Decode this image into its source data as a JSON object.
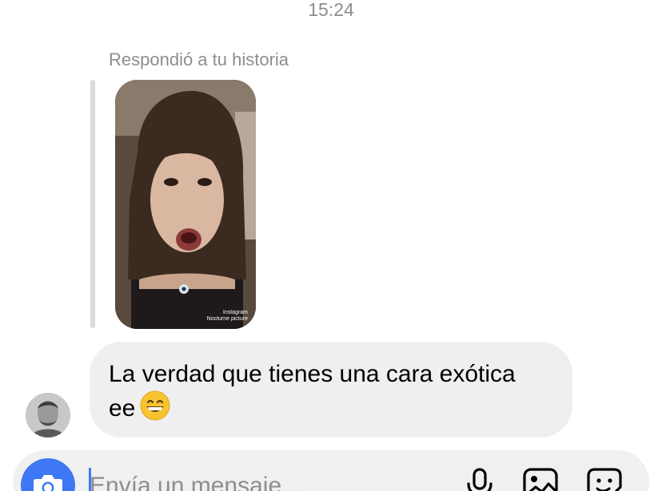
{
  "header": {
    "time": "15:24"
  },
  "thread": {
    "reply_context": "Respondió a tu historia",
    "story": {
      "caption_line1": "Instagram",
      "caption_line2": "Nocturne picture"
    },
    "message": {
      "line1": "La verdad que tienes una cara exótica",
      "line2": "ee",
      "emoji": "grinning-face-with-smiling-eyes"
    }
  },
  "composer": {
    "placeholder": "Envía un mensaje...",
    "value": "",
    "icons": [
      "camera-icon",
      "microphone-icon",
      "gallery-icon",
      "sticker-icon"
    ]
  },
  "colors": {
    "accent": "#3f78f4",
    "bubble": "#efefef",
    "muted_text": "#8e8e8e",
    "composer_bg": "#f0f0f0"
  }
}
